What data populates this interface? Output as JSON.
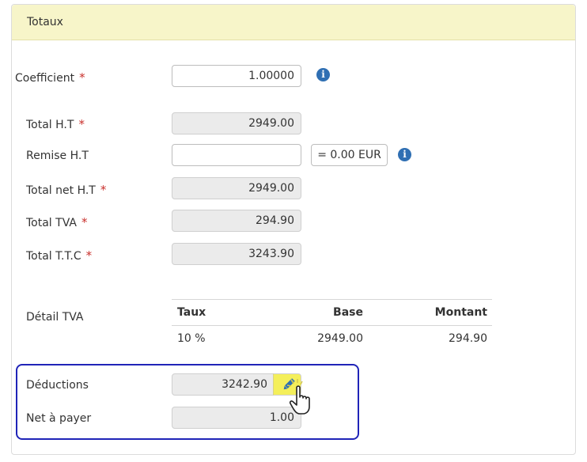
{
  "panel": {
    "title": "Totaux"
  },
  "required_mark": "*",
  "fields": {
    "coefficient": {
      "label": "Coefficient",
      "value": "1.00000"
    },
    "total_ht": {
      "label": "Total H.T",
      "value": "2949.00"
    },
    "remise_ht": {
      "label": "Remise H.T",
      "value": "",
      "converted": "= 0.00 EUR"
    },
    "total_net_ht": {
      "label": "Total net H.T",
      "value": "2949.00"
    },
    "total_tva": {
      "label": "Total TVA",
      "value": "294.90"
    },
    "total_ttc": {
      "label": "Total T.T.C",
      "value": "3243.90"
    }
  },
  "detail_tva": {
    "label": "Détail TVA",
    "headers": [
      "Taux",
      "Base",
      "Montant"
    ],
    "rows": [
      [
        "10 %",
        "2949.00",
        "294.90"
      ]
    ]
  },
  "deductions": {
    "label": "Déductions",
    "value": "3242.90"
  },
  "net_a_payer": {
    "label": "Net à payer",
    "value": "1.00"
  },
  "icons": {
    "info": "info-icon",
    "edit": "pencil-icon",
    "cursor": "hand-pointer-icon"
  },
  "colors": {
    "header_bg": "#f7f5c9",
    "required": "#c9302c",
    "highlight": "#2024b8",
    "edit_button": "#f4ef5a",
    "info": "#2f6fb3"
  }
}
